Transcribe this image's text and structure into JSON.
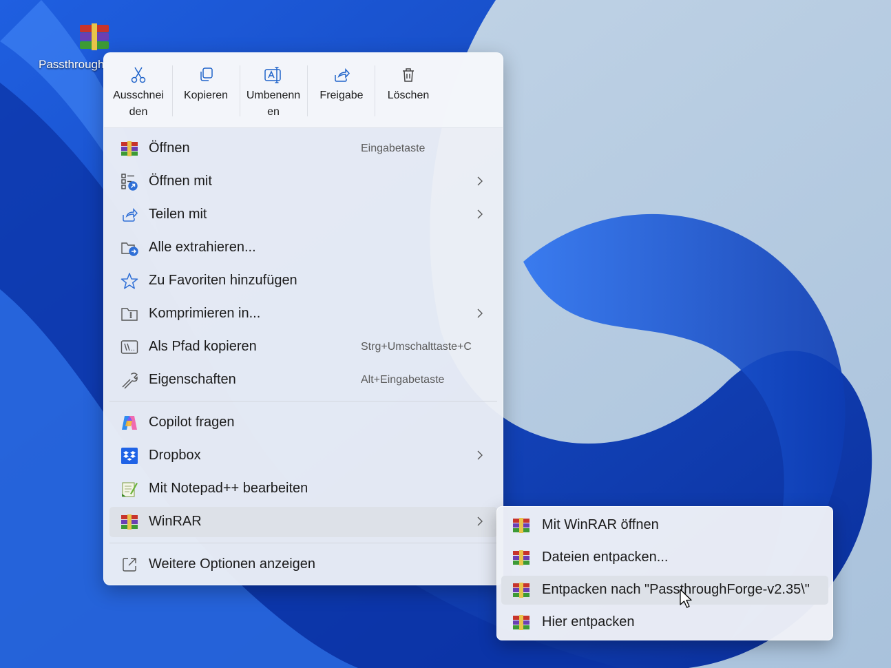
{
  "desktop": {
    "file_icon_label": "Passthrough",
    "file_icon": "winrar-archive-icon"
  },
  "toolbar": {
    "cut": {
      "label": "Ausschneiden",
      "line1": "Ausschnei",
      "line2": "den",
      "icon": "scissors-icon"
    },
    "copy": {
      "label": "Kopieren",
      "icon": "copy-icon"
    },
    "rename": {
      "label": "Umbenennen",
      "line1": "Umbenenn",
      "line2": "en",
      "icon": "rename-icon"
    },
    "share": {
      "label": "Freigabe",
      "icon": "share-icon"
    },
    "delete": {
      "label": "Löschen",
      "icon": "trash-icon"
    }
  },
  "menu": {
    "items": [
      {
        "label": "Öffnen",
        "shortcut": "Eingabetaste",
        "icon": "winrar-icon",
        "submenu": false
      },
      {
        "label": "Öffnen mit",
        "shortcut": "",
        "icon": "open-with-icon",
        "submenu": true
      },
      {
        "label": "Teilen mit",
        "shortcut": "",
        "icon": "share-icon",
        "submenu": true
      },
      {
        "label": "Alle extrahieren...",
        "shortcut": "",
        "icon": "extract-folder-icon",
        "submenu": false
      },
      {
        "label": "Zu Favoriten hinzufügen",
        "shortcut": "",
        "icon": "star-icon",
        "submenu": false
      },
      {
        "label": "Komprimieren in...",
        "shortcut": "",
        "icon": "zip-folder-icon",
        "submenu": true
      },
      {
        "label": "Als Pfad kopieren",
        "shortcut": "Strg+Umschalttaste+C",
        "icon": "path-icon",
        "submenu": false
      },
      {
        "label": "Eigenschaften",
        "shortcut": "Alt+Eingabetaste",
        "icon": "wrench-icon",
        "submenu": false
      }
    ],
    "extra_items": [
      {
        "label": "Copilot fragen",
        "icon": "copilot-icon",
        "submenu": false
      },
      {
        "label": "Dropbox",
        "icon": "dropbox-icon",
        "submenu": true
      },
      {
        "label": "Mit Notepad++ bearbeiten",
        "icon": "notepadpp-icon",
        "submenu": false
      },
      {
        "label": "WinRAR",
        "icon": "winrar-icon",
        "submenu": true,
        "highlighted": true
      }
    ],
    "more_options": {
      "label": "Weitere Optionen anzeigen",
      "icon": "more-options-icon"
    }
  },
  "winrar_submenu": {
    "items": [
      {
        "label": "Mit WinRAR öffnen",
        "icon": "winrar-icon"
      },
      {
        "label": "Dateien entpacken...",
        "icon": "winrar-icon"
      },
      {
        "label": "Entpacken nach \"PassthroughForge-v2.35\\\"",
        "icon": "winrar-icon",
        "highlighted": true
      },
      {
        "label": "Hier entpacken",
        "icon": "winrar-icon"
      }
    ]
  },
  "colors": {
    "accent": "#2f6fd6",
    "menu_bg": "#eceff6",
    "highlight": "#dde1e8",
    "text": "#1b1b1b",
    "shortcut_text": "#5c5c5c"
  }
}
